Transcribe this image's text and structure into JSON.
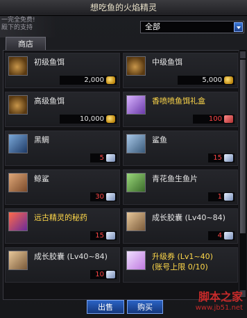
{
  "window": {
    "title": "想吃鱼的火焰精灵"
  },
  "background_text": [
    "一完全免费!",
    "殿下的支持"
  ],
  "filter": {
    "selected": "全部"
  },
  "tabs": [
    {
      "label": "商店"
    }
  ],
  "items": [
    {
      "name": "初级鱼饵",
      "name_line2": "",
      "name_color": "#e6e6e6",
      "price": "2,000",
      "currency": "gold-coin-icon",
      "price_color": "#e8e8e8",
      "icon": "fish-bait-bag-icon"
    },
    {
      "name": "中级鱼饵",
      "name_line2": "",
      "name_color": "#e6e6e6",
      "price": "5,000",
      "currency": "gold-coin-icon",
      "price_color": "#e8e8e8",
      "icon": "fish-bait-bag-icon"
    },
    {
      "name": "高级鱼饵",
      "name_line2": "",
      "name_color": "#e6e6e6",
      "price": "10,000",
      "currency": "gold-coin-icon",
      "price_color": "#e8e8e8",
      "icon": "fish-bait-bag-icon"
    },
    {
      "name": "香喷喷鱼饵礼盒",
      "name_line2": "",
      "name_color": "#ffd84a",
      "price": "100",
      "currency": "cera-icon",
      "price_color": "#ff4646",
      "icon": "gift-box-icon"
    },
    {
      "name": "黑鲷",
      "name_line2": "",
      "name_color": "#e6e6e6",
      "price": "5",
      "currency": "fishing-ticket-icon",
      "price_color": "#ff4646",
      "icon": "fish-icon"
    },
    {
      "name": "鲨鱼",
      "name_line2": "",
      "name_color": "#e6e6e6",
      "price": "15",
      "currency": "fishing-ticket-icon",
      "price_color": "#ff4646",
      "icon": "shark-icon"
    },
    {
      "name": "鲸鲨",
      "name_line2": "",
      "name_color": "#e6e6e6",
      "price": "30",
      "currency": "fishing-ticket-icon",
      "price_color": "#ff4646",
      "icon": "whale-shark-icon"
    },
    {
      "name": "青花鱼生鱼片",
      "name_line2": "",
      "name_color": "#e6e6e6",
      "price": "1",
      "currency": "fishing-ticket-icon",
      "price_color": "#ff4646",
      "icon": "sashimi-icon"
    },
    {
      "name": "远古精灵的秘药",
      "name_line2": "",
      "name_color": "#ffd84a",
      "price": "15",
      "currency": "fishing-ticket-icon",
      "price_color": "#ff4646",
      "icon": "potion-exp-icon"
    },
    {
      "name": "成长胶囊 (Lv40~84)",
      "name_line2": "",
      "name_color": "#e6e6e6",
      "price": "4",
      "currency": "fishing-ticket-icon",
      "price_color": "#ff4646",
      "icon": "growth-capsule-icon"
    },
    {
      "name": "成长胶囊 (Lv40~84)",
      "name_line2": "",
      "name_color": "#e6e6e6",
      "price": "10",
      "currency": "fishing-ticket-icon",
      "price_color": "#ff4646",
      "icon": "growth-capsule-icon"
    },
    {
      "name": "升级券 (Lv1~40)",
      "name_line2": "(账号上限 0/10)",
      "name_color": "#ffd84a",
      "price": "",
      "currency": "",
      "price_color": "#e8e8e8",
      "icon": "level-up-ticket-icon"
    }
  ],
  "buttons": {
    "sell": "出售",
    "buy": "购买"
  },
  "watermark": {
    "line1": "脚本之家",
    "line2": "www.jb51.net"
  },
  "colors": {
    "accent_blue": "#2a62c4",
    "price_red": "#ff4646",
    "highlight_yellow": "#ffd84a"
  }
}
